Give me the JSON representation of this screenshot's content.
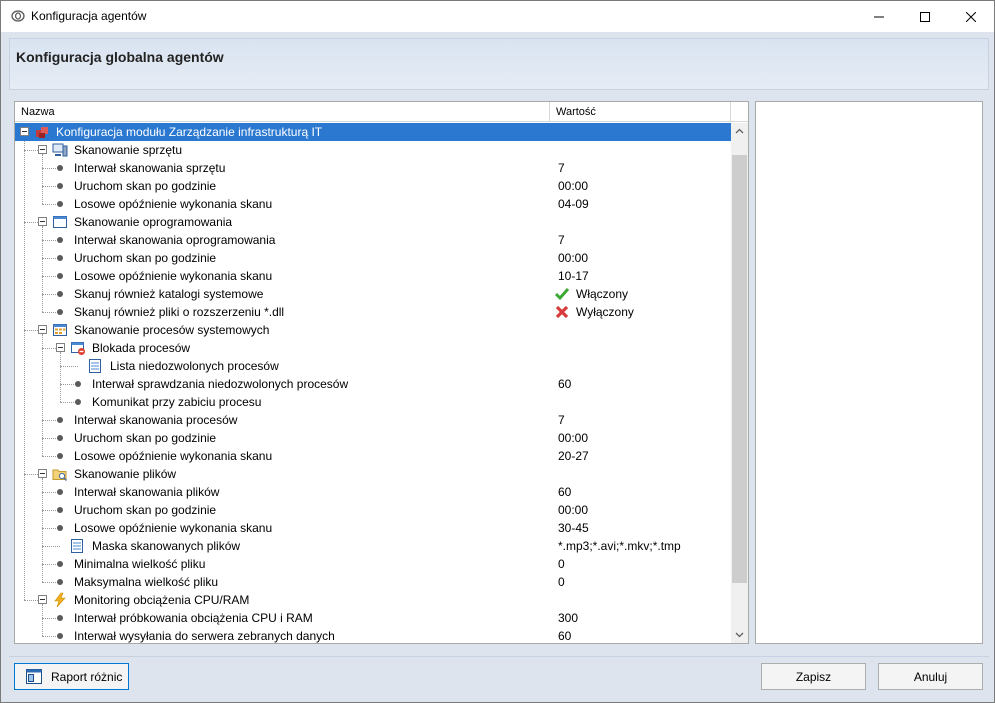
{
  "window": {
    "title": "Konfiguracja agentów"
  },
  "header": {
    "title": "Konfiguracja globalna agentów"
  },
  "tree": {
    "columns": {
      "name": "Nazwa",
      "value": "Wartość"
    },
    "rows": [
      {
        "label": "Konfiguracja modułu Zarządzanie infrastrukturą IT",
        "value": "",
        "level": 0,
        "kind": "root",
        "icon": "cube-stack-icon",
        "selected": true
      },
      {
        "label": "Skanowanie sprzętu",
        "value": "",
        "level": 1,
        "kind": "group",
        "icon": "computer-icon"
      },
      {
        "label": "Interwał skanowania sprzętu",
        "value": "7",
        "level": 2,
        "kind": "leaf"
      },
      {
        "label": "Uruchom skan po godzinie",
        "value": "00:00",
        "level": 2,
        "kind": "leaf"
      },
      {
        "label": "Losowe opóźnienie wykonania skanu",
        "value": "04-09",
        "level": 2,
        "kind": "leaf"
      },
      {
        "label": "Skanowanie oprogramowania",
        "value": "",
        "level": 1,
        "kind": "group",
        "icon": "window-icon"
      },
      {
        "label": "Interwał skanowania oprogramowania",
        "value": "7",
        "level": 2,
        "kind": "leaf"
      },
      {
        "label": "Uruchom skan po godzinie",
        "value": "00:00",
        "level": 2,
        "kind": "leaf"
      },
      {
        "label": "Losowe opóźnienie wykonania skanu",
        "value": "10-17",
        "level": 2,
        "kind": "leaf"
      },
      {
        "label": "Skanuj również katalogi systemowe",
        "value": "Włączony",
        "level": 2,
        "kind": "leaf",
        "value_icon": "check-icon"
      },
      {
        "label": "Skanuj również pliki o rozszerzeniu *.dll",
        "value": "Wyłączony",
        "level": 2,
        "kind": "leaf",
        "value_icon": "cross-icon"
      },
      {
        "label": "Skanowanie procesów systemowych",
        "value": "",
        "level": 1,
        "kind": "group",
        "icon": "process-grid-icon"
      },
      {
        "label": "Blokada procesów",
        "value": "",
        "level": 2,
        "kind": "group",
        "icon": "block-process-icon"
      },
      {
        "label": "Lista niedozwolonych procesów",
        "value": "",
        "level": 3,
        "kind": "list",
        "icon": "list-icon"
      },
      {
        "label": "Interwał sprawdzania niedozwolonych procesów",
        "value": "60",
        "level": 3,
        "kind": "leaf"
      },
      {
        "label": "Komunikat przy zabiciu procesu",
        "value": "",
        "level": 3,
        "kind": "leaf"
      },
      {
        "label": "Interwał skanowania procesów",
        "value": "7",
        "level": 2,
        "kind": "leaf"
      },
      {
        "label": "Uruchom skan po godzinie",
        "value": "00:00",
        "level": 2,
        "kind": "leaf"
      },
      {
        "label": "Losowe opóźnienie wykonania skanu",
        "value": "20-27",
        "level": 2,
        "kind": "leaf"
      },
      {
        "label": "Skanowanie plików",
        "value": "",
        "level": 1,
        "kind": "group",
        "icon": "folder-search-icon"
      },
      {
        "label": "Interwał skanowania plików",
        "value": "60",
        "level": 2,
        "kind": "leaf"
      },
      {
        "label": "Uruchom skan po godzinie",
        "value": "00:00",
        "level": 2,
        "kind": "leaf"
      },
      {
        "label": "Losowe opóźnienie wykonania skanu",
        "value": "30-45",
        "level": 2,
        "kind": "leaf"
      },
      {
        "label": "Maska skanowanych plików",
        "value": "*.mp3;*.avi;*.mkv;*.tmp",
        "level": 2,
        "kind": "list",
        "icon": "list-icon"
      },
      {
        "label": "Minimalna wielkość pliku",
        "value": "0",
        "level": 2,
        "kind": "leaf"
      },
      {
        "label": "Maksymalna wielkość pliku",
        "value": "0",
        "level": 2,
        "kind": "leaf"
      },
      {
        "label": "Monitoring obciążenia CPU/RAM",
        "value": "",
        "level": 1,
        "kind": "group",
        "icon": "lightning-icon"
      },
      {
        "label": "Interwał próbkowania obciążenia CPU i RAM",
        "value": "300",
        "level": 2,
        "kind": "leaf"
      },
      {
        "label": "Interwał wysyłania do serwera zebranych danych",
        "value": "60",
        "level": 2,
        "kind": "leaf"
      }
    ]
  },
  "footer": {
    "report_label": "Raport różnic",
    "save_label": "Zapisz",
    "cancel_label": "Anuluj"
  },
  "colors": {
    "selection": "#2b78d1",
    "panel_background": "#dde4ee",
    "check": "#3aa832",
    "cross": "#d83b3b"
  }
}
